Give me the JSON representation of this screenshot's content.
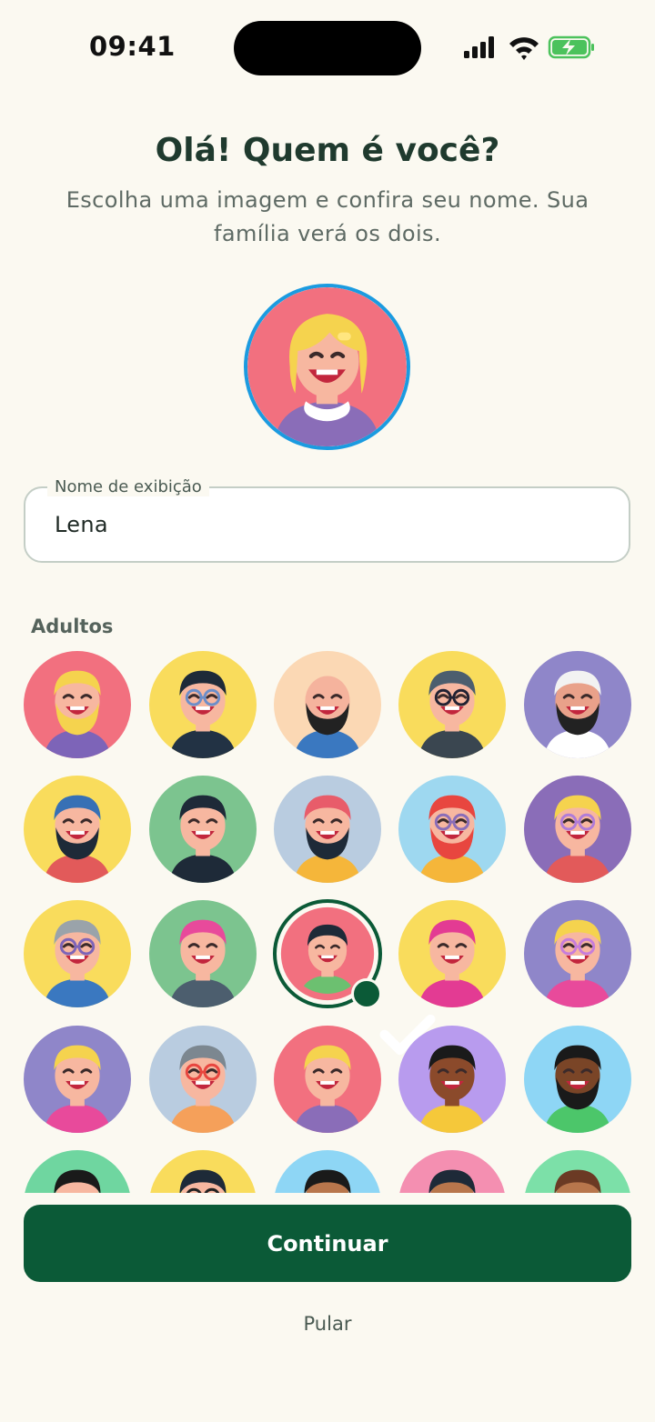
{
  "status_bar": {
    "time": "09:41",
    "icons": [
      "signal-icon",
      "wifi-icon",
      "battery-charging-icon"
    ]
  },
  "header": {
    "title": "Olá! Quem é você?",
    "subtitle": "Escolha uma imagem e confira seu nome. Sua família verá os dois."
  },
  "name_field": {
    "label": "Nome de exibição",
    "value": "Lena"
  },
  "avatars": {
    "section_label": "Adultos",
    "selected_index": 12,
    "items": [
      {
        "bg": "#F2707F",
        "hair": "#F5D34E",
        "beard": "#F5D34E",
        "skin": "#F7B7A0",
        "shirt": "#7D64B8"
      },
      {
        "bg": "#F9DC5C",
        "hair": "#1E2A38",
        "beard": "",
        "skin": "#F7B7A0",
        "shirt": "#223244",
        "glasses": "#6C8EC9"
      },
      {
        "bg": "#FBD8B4",
        "hair": "",
        "beard": "#222",
        "skin": "#F5B39D",
        "shirt": "#3A78C0"
      },
      {
        "bg": "#F9DC5C",
        "hair": "#4C5E6E",
        "beard": "",
        "skin": "#F7B7A0",
        "shirt": "#3A4650",
        "glasses": "#223"
      },
      {
        "bg": "#8F86C9",
        "hair": "#F2F2F2",
        "beard": "#222",
        "skin": "#E9A18A",
        "shirt": "#FFFFFF"
      },
      {
        "bg": "#F9DC5C",
        "hair": "#3770B5",
        "beard": "#1E2A38",
        "skin": "#F7B7A0",
        "shirt": "#E25A5A"
      },
      {
        "bg": "#7CC48F",
        "hair": "#1E2A38",
        "beard": "",
        "skin": "#F7B7A0",
        "shirt": "#1E2A38"
      },
      {
        "bg": "#B9CCE0",
        "hair": "#E85C6A",
        "beard": "#1E2A38",
        "skin": "#F7B7A0",
        "shirt": "#F5B63A"
      },
      {
        "bg": "#9ED8F0",
        "hair": "#E8463F",
        "beard": "#E8463F",
        "skin": "#F7B7A0",
        "shirt": "#F5B63A",
        "glasses": "#8A6DB8"
      },
      {
        "bg": "#8A6DB8",
        "hair": "#F5D34E",
        "beard": "",
        "skin": "#F7B7A0",
        "shirt": "#E25A5A",
        "glasses": "#B07CD8"
      },
      {
        "bg": "#F9DC5C",
        "hair": "#9AA3AA",
        "beard": "",
        "skin": "#F7B7A0",
        "shirt": "#3A78C0",
        "glasses": "#7D64B8"
      },
      {
        "bg": "#7CC48F",
        "hair": "#E84A9B",
        "beard": "",
        "skin": "#F7B7A0",
        "shirt": "#4C5E6E"
      },
      {
        "bg": "#F2707F",
        "hair": "#1E2A38",
        "beard": "",
        "skin": "#F7B7A0",
        "shirt": "#6CC070"
      },
      {
        "bg": "#F9DC5C",
        "hair": "#E33B93",
        "beard": "",
        "skin": "#F7B7A0",
        "shirt": "#E33B93"
      },
      {
        "bg": "#8F86C9",
        "hair": "#F5D34E",
        "beard": "",
        "skin": "#F7B7A0",
        "shirt": "#E84A9B",
        "glasses": "#C77DDB"
      },
      {
        "bg": "#8F86C9",
        "hair": "#F5D34E",
        "beard": "",
        "skin": "#F7B7A0",
        "shirt": "#E84A9B"
      },
      {
        "bg": "#B9CCE0",
        "hair": "#7C8790",
        "beard": "",
        "skin": "#F7B7A0",
        "shirt": "#F5A05A",
        "glasses": "#E8463F"
      },
      {
        "bg": "#F2707F",
        "hair": "#F5D34E",
        "beard": "",
        "skin": "#F7B7A0",
        "shirt": "#8A6DB8"
      },
      {
        "bg": "#B89BEE",
        "hair": "#1A1A1A",
        "beard": "",
        "skin": "#8B4A2B",
        "shirt": "#F5C83A"
      },
      {
        "bg": "#8ED6F5",
        "hair": "#1A1A1A",
        "beard": "#1A1A1A",
        "skin": "#7A4527",
        "shirt": "#4CC66A"
      },
      {
        "bg": "#6FD6A0",
        "hair": "#1A1A1A",
        "beard": "",
        "skin": "#F7B7A0",
        "shirt": "#4CC66A"
      },
      {
        "bg": "#F9DC5C",
        "hair": "#1E2A38",
        "beard": "",
        "skin": "#F7B7A0",
        "shirt": "#3A78C0",
        "glasses": "#222"
      },
      {
        "bg": "#8ED6F5",
        "hair": "#1A1A1A",
        "beard": "",
        "skin": "#B8764C",
        "shirt": "#E25A5A"
      },
      {
        "bg": "#F48FB1",
        "hair": "#1E2A38",
        "beard": "",
        "skin": "#B8764C",
        "shirt": "#3A78C0"
      },
      {
        "bg": "#7CE0A8",
        "hair": "#6B3A24",
        "beard": "",
        "skin": "#B8764C",
        "shirt": "#E25A5A"
      }
    ]
  },
  "actions": {
    "continue_label": "Continuar",
    "skip_label": "Pular"
  },
  "colors": {
    "primary": "#0B5A37",
    "background": "#FBF9F1",
    "selected_avatar_border": "#1B9BE0"
  }
}
